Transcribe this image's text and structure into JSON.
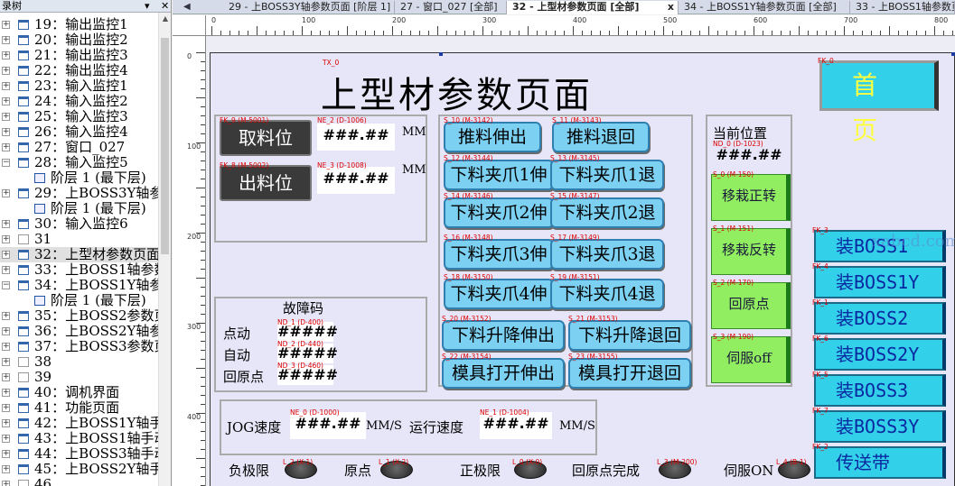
{
  "tree": {
    "header": "录树",
    "pin": "▾",
    "close": "✕",
    "rows": [
      {
        "label": "19：输出监控1"
      },
      {
        "label": "20：输出监控2"
      },
      {
        "label": "21：输出监控3"
      },
      {
        "label": "22：输出监控4"
      },
      {
        "label": "23：输入监控1"
      },
      {
        "label": "24：输入监控2"
      },
      {
        "label": "25：输入监控3"
      },
      {
        "label": "26：输入监控4"
      },
      {
        "label": "27：窗口_027"
      },
      {
        "label": "28：输入监控5"
      },
      {
        "label": "阶层 1 (最下层)"
      },
      {
        "label": "29：上BOSS3Y轴参..."
      },
      {
        "label": "阶层 1 (最下层)"
      },
      {
        "label": "30：输入监控6"
      },
      {
        "label": "31"
      },
      {
        "label": "32：上型材参数页面"
      },
      {
        "label": "33：上BOSS1轴参数..."
      },
      {
        "label": "34：上BOSS1Y轴参..."
      },
      {
        "label": "阶层 1 (最下层)"
      },
      {
        "label": "35：上BOSS2参数页面"
      },
      {
        "label": "36：上BOSS2Y轴参..."
      },
      {
        "label": "37：上BOSS3参数页面"
      },
      {
        "label": "38"
      },
      {
        "label": "39"
      },
      {
        "label": "40：调机界面"
      },
      {
        "label": "41：功能页面"
      },
      {
        "label": "42：上BOSS1Y轴手..."
      },
      {
        "label": "43：上BOSS1轴手动..."
      },
      {
        "label": "44：上BOSS3轴手动..."
      },
      {
        "label": "45：上BOSS2Y轴手..."
      },
      {
        "label": "46"
      }
    ]
  },
  "tabs": [
    {
      "label": "29 - 上BOSS3Y轴参数页面 [阶层 1]"
    },
    {
      "label": "27 - 窗口_027 [全部]"
    },
    {
      "label": "32 - 上型材参数页面 [全部]"
    },
    {
      "label": "34 - 上BOSS1Y轴参数页面 [全部]"
    },
    {
      "label": "33 - 上BOSS1轴参数页"
    }
  ],
  "tab_close": "x",
  "tab_prev": "◀",
  "ruler_top": [
    "0",
    "100",
    "200",
    "300",
    "400",
    "500",
    "600",
    "700",
    "800"
  ],
  "ruler_left": [
    "0",
    "100",
    "200",
    "300",
    "400"
  ],
  "page": {
    "title_tag": "TX_0",
    "title": "上型材参数页面",
    "home_tag": "FK_0",
    "home_label": "首 页",
    "take": {
      "tag": "FK_9 (M-5001)",
      "label": "取料位",
      "num_tag": "NE_2 (D-1006)",
      "value": "###.##",
      "unit": "MM"
    },
    "out": {
      "tag": "FK_8 (M-5002)",
      "label": "出料位",
      "num_tag": "NE_3 (D-1008)",
      "value": "###.##",
      "unit": "MM"
    },
    "cyl_buttons": [
      {
        "tag": "S_10 (M-3142)",
        "label": "推料伸出"
      },
      {
        "tag": "S_11 (M-3143)",
        "label": "推料退回"
      },
      {
        "tag": "S_12 (M-3144)",
        "label": "下料夹爪1伸"
      },
      {
        "tag": "S_13 (M-3145)",
        "label": "下料夹爪1退"
      },
      {
        "tag": "S_14 (M-3146)",
        "label": "下料夹爪2伸"
      },
      {
        "tag": "S_15 (M-3147)",
        "label": "下料夹爪2退"
      },
      {
        "tag": "S_16 (M-3148)",
        "label": "下料夹爪3伸"
      },
      {
        "tag": "S_17 (M-3149)",
        "label": "下料夹爪3退"
      },
      {
        "tag": "S_18 (M-3150)",
        "label": "下料夹爪4伸"
      },
      {
        "tag": "S_19 (M-3151)",
        "label": "下料夹爪4退"
      },
      {
        "tag": "S_20 (M-3152)",
        "label": "下料升降伸出"
      },
      {
        "tag": "S_21 (M-3153)",
        "label": "下料升降退回"
      },
      {
        "tag": "S_22 (M-3154)",
        "label": "模具打开伸出"
      },
      {
        "tag": "S_23 (M-3155)",
        "label": "模具打开退回"
      }
    ],
    "position": {
      "label": "当前位置",
      "num_tag": "ND_0 (D-1023)",
      "value": "###.##"
    },
    "green_buttons": [
      {
        "tag": "S_0 (M-150)",
        "label": "移栽正转"
      },
      {
        "tag": "S_1 (M-151)",
        "label": "移栽反转"
      },
      {
        "tag": "S_2 (M-170)",
        "label": "回原点"
      },
      {
        "tag": "S_3 (M-190)",
        "label": "伺服off"
      }
    ],
    "fault": {
      "title": "故障码",
      "rows": [
        {
          "label": "点动",
          "tag": "ND_1 (D-400)",
          "value": "#####"
        },
        {
          "label": "自动",
          "tag": "ND_2 (D-440)",
          "value": "#####"
        },
        {
          "label": "回原点",
          "tag": "ND_3 (D-460)",
          "value": "#####"
        }
      ]
    },
    "speed": {
      "jog_label": "JOG速度",
      "jog_tag": "NE_0 (D-1000)",
      "jog_value": "###.##",
      "jog_unit": "MM/S",
      "run_label": "运行速度",
      "run_tag": "NE_1 (D-1004)",
      "run_value": "###.##",
      "run_unit": "MM/S"
    },
    "lamps": [
      {
        "label": "负极限",
        "tag": "L_2 (X-1)"
      },
      {
        "label": "原点",
        "tag": "L_1 (X-2)"
      },
      {
        "label": "正极限",
        "tag": "L_0 (X-0)"
      },
      {
        "label": "回原点完成",
        "tag": "L_3 (M-200)"
      },
      {
        "label": "伺服ON",
        "tag": "L_4 (B-1)"
      }
    ],
    "side_buttons": [
      {
        "tag": "FK_3",
        "label": "装BOSS1"
      },
      {
        "tag": "FK_4",
        "label": "装BOSS1Y"
      },
      {
        "tag": "FK_1",
        "label": "装BOSS2"
      },
      {
        "tag": "FK_6",
        "label": "装BOSS2Y"
      },
      {
        "tag": "FK_5",
        "label": "装BOSS3"
      },
      {
        "tag": "FK_7",
        "label": "装BOSS3Y"
      },
      {
        "tag": "FK_2",
        "label": "传送带"
      }
    ],
    "watermark": "xabcd.com"
  },
  "colors": {
    "accent_cyan": "#33d0ea",
    "button_blue": "#7cd0f2",
    "green": "#90ee60",
    "home_text": "#ffff40"
  }
}
